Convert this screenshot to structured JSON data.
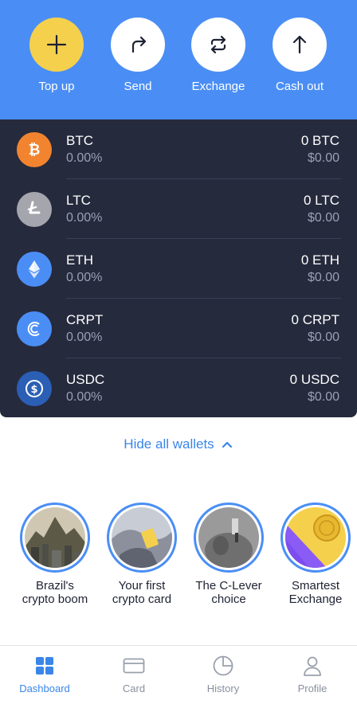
{
  "actions": [
    {
      "label": "Top up",
      "icon": "plus-icon"
    },
    {
      "label": "Send",
      "icon": "send-arrow-icon"
    },
    {
      "label": "Exchange",
      "icon": "exchange-icon"
    },
    {
      "label": "Cash out",
      "icon": "arrow-up-icon"
    }
  ],
  "wallets": [
    {
      "symbol": "BTC",
      "percent": "0.00%",
      "amount": "0 BTC",
      "usd": "$0.00",
      "color": "#f2842f",
      "icon": "bitcoin-icon"
    },
    {
      "symbol": "LTC",
      "percent": "0.00%",
      "amount": "0 LTC",
      "usd": "$0.00",
      "color": "#a5a5ad",
      "icon": "litecoin-icon"
    },
    {
      "symbol": "ETH",
      "percent": "0.00%",
      "amount": "0 ETH",
      "usd": "$0.00",
      "color": "#4a8ef5",
      "icon": "ethereum-icon"
    },
    {
      "symbol": "CRPT",
      "percent": "0.00%",
      "amount": "0 CRPT",
      "usd": "$0.00",
      "color": "#4a8ef5",
      "icon": "crypterium-icon"
    },
    {
      "symbol": "USDC",
      "percent": "0.00%",
      "amount": "0 USDC",
      "usd": "$0.00",
      "color": "#2a5fb5",
      "icon": "usdc-icon"
    }
  ],
  "hide_wallets_label": "Hide all wallets",
  "stories": [
    {
      "line1": "Brazil's",
      "line2": "crypto boom"
    },
    {
      "line1": "Your first",
      "line2": "crypto card"
    },
    {
      "line1": "The C-Lever",
      "line2": "choice"
    },
    {
      "line1": "Smartest",
      "line2": "Exchange"
    }
  ],
  "nav": [
    {
      "label": "Dashboard",
      "icon": "dashboard-grid-icon",
      "active": true
    },
    {
      "label": "Card",
      "icon": "card-icon",
      "active": false
    },
    {
      "label": "History",
      "icon": "history-pie-icon",
      "active": false
    },
    {
      "label": "Profile",
      "icon": "profile-icon",
      "active": false
    }
  ],
  "colors": {
    "accent": "#4a8ef5",
    "topup_yellow": "#f5d04c",
    "wallet_bg": "#262a3d",
    "link_blue": "#3a86e8"
  }
}
